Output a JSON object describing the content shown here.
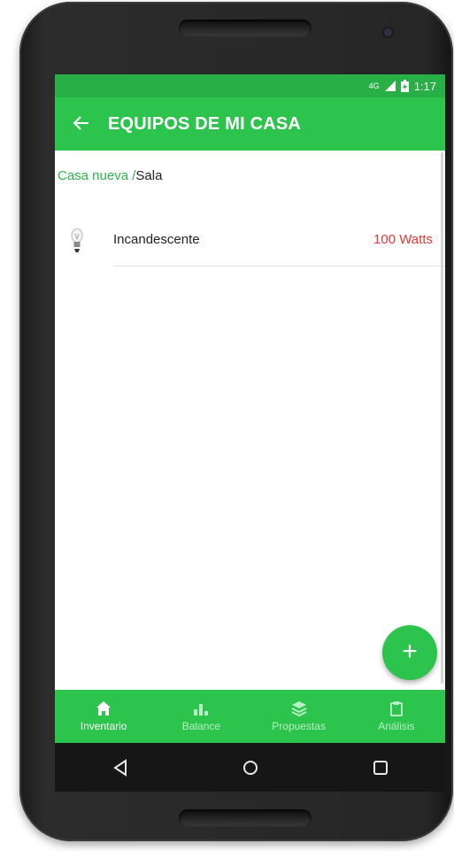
{
  "status_bar": {
    "network": "4G",
    "time": "1:17"
  },
  "app_bar": {
    "back_icon": "arrow-left-icon",
    "title": "EQUIPOS DE MI CASA"
  },
  "breadcrumb": {
    "parent": "Casa nueva /",
    "current": "Sala"
  },
  "equipment": [
    {
      "icon": "lightbulb-icon",
      "name": "Incandescente",
      "power": "100 Watts"
    }
  ],
  "fab": {
    "icon": "plus-icon",
    "label": "+"
  },
  "bottom_nav": {
    "items": [
      {
        "label": "Inventario",
        "icon": "home-icon",
        "active": true
      },
      {
        "label": "Balance",
        "icon": "bar-chart-icon",
        "active": false
      },
      {
        "label": "Propuestas",
        "icon": "layers-icon",
        "active": false
      },
      {
        "label": "Análisis",
        "icon": "clipboard-icon",
        "active": false
      }
    ]
  },
  "colors": {
    "primary": "#2cc44d",
    "status_bar": "#28b046",
    "power_value": "#e53935",
    "link": "#2cb54a"
  }
}
